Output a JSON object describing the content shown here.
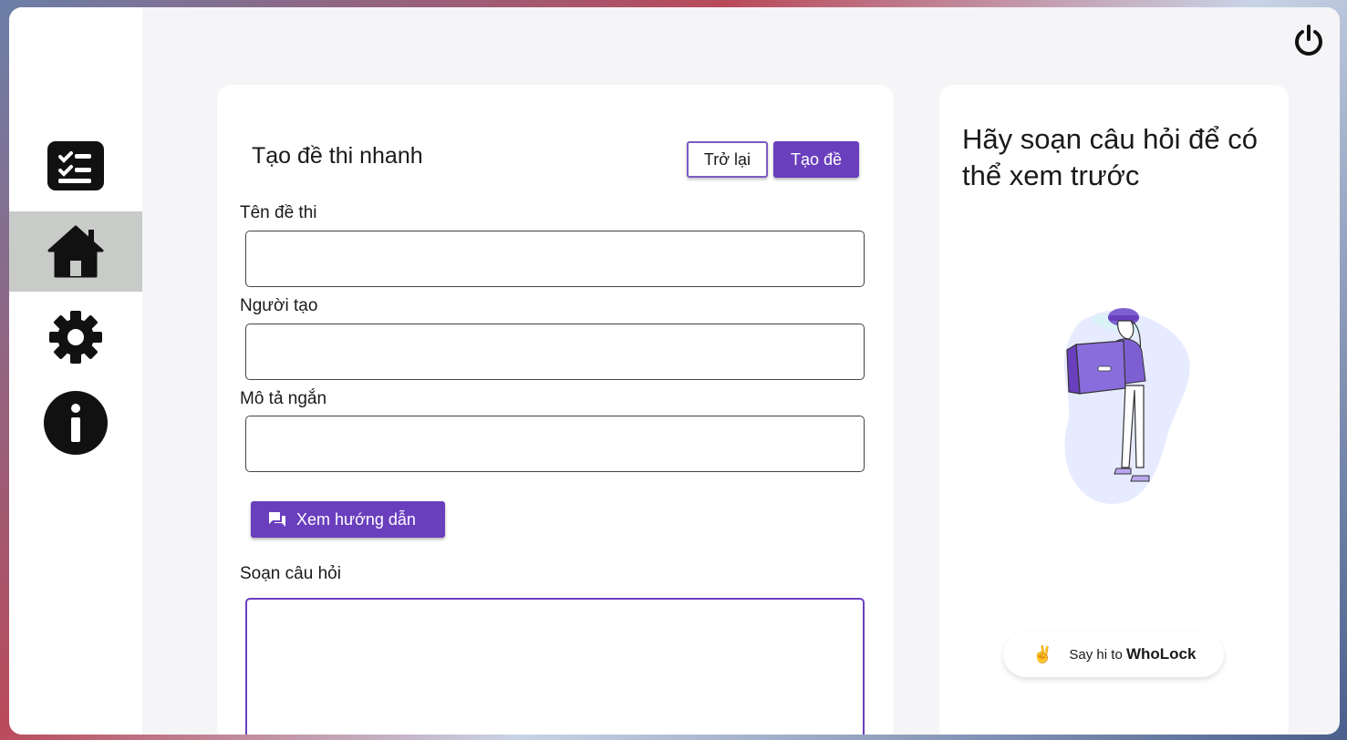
{
  "nav": {
    "items": [
      {
        "name": "dashboard",
        "icon": "list-icon",
        "active": false
      },
      {
        "name": "home",
        "icon": "home-icon",
        "active": true
      },
      {
        "name": "settings",
        "icon": "gear-icon",
        "active": false
      },
      {
        "name": "info",
        "icon": "info-icon",
        "active": false
      }
    ]
  },
  "form": {
    "title": "Tạo đề thi nhanh",
    "back_label": "Trở lại",
    "create_label": "Tạo đề",
    "name_label": "Tên đề thi",
    "name_value": "",
    "author_label": "Người tạo",
    "author_value": "",
    "desc_label": "Mô tả ngắn",
    "desc_value": "",
    "guide_label": "Xem hướng dẫn",
    "compose_label": "Soạn câu hỏi",
    "compose_value": ""
  },
  "preview": {
    "title": "Hãy soạn câu hỏi để có thể xem trước",
    "chip_prefix": "Say hi to",
    "chip_brand": "WhoLock"
  },
  "colors": {
    "accent": "#6a3fbe",
    "nav_active": "#c8cbc8"
  }
}
